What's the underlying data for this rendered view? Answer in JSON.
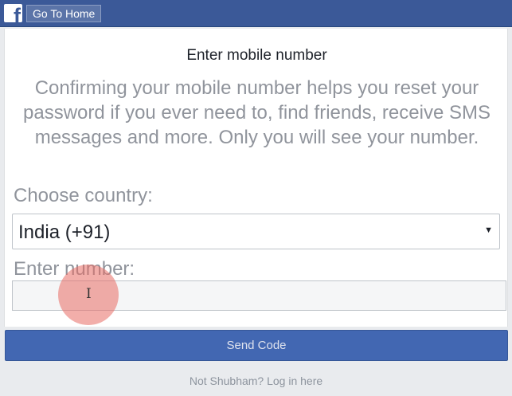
{
  "header": {
    "logo_icon": "facebook-f-icon",
    "home_button_label": "Go To Home"
  },
  "main": {
    "title": "Enter mobile number",
    "description": "Confirming your mobile number helps you reset your password if you ever need to, find friends, receive SMS messages and more. Only you will see your number.",
    "country_label": "Choose country:",
    "country_selected": "India (+91)",
    "number_label": "Enter number:",
    "number_value": ""
  },
  "actions": {
    "send_code_label": "Send Code"
  },
  "footer": {
    "switch_account_link": "Not Shubham? Log in here"
  },
  "colors": {
    "brand": "#3b5998",
    "button": "#4267b2",
    "muted_text": "#90949c"
  }
}
